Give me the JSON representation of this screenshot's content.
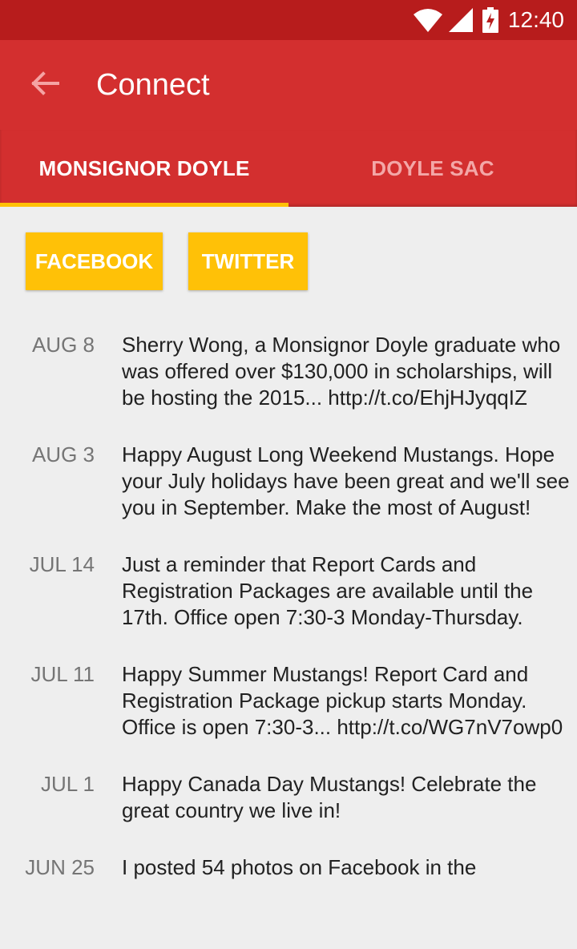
{
  "status_bar": {
    "time": "12:40"
  },
  "toolbar": {
    "title": "Connect"
  },
  "tabs": [
    {
      "label": "MONSIGNOR DOYLE"
    },
    {
      "label": "DOYLE SAC"
    }
  ],
  "buttons": {
    "facebook": "FACEBOOK",
    "twitter": "TWITTER"
  },
  "feed": [
    {
      "date": "AUG 8",
      "text": "Sherry Wong, a Monsignor Doyle graduate who was offered over $130,000 in scholarships, will be hosting the 2015... http://t.co/EhjHJyqqIZ"
    },
    {
      "date": "AUG 3",
      "text": "Happy August Long Weekend Mustangs. Hope your July holidays have been great and we'll see you in September. Make the most of August!"
    },
    {
      "date": "JUL 14",
      "text": "Just a reminder that Report Cards and Registration Packages are available until the 17th. Office open 7:30-3 Monday-Thursday."
    },
    {
      "date": "JUL 11",
      "text": "Happy Summer Mustangs! Report Card and Registration Package pickup starts Monday. Office is open 7:30-3... http://t.co/WG7nV7owp0"
    },
    {
      "date": "JUL 1",
      "text": "Happy Canada Day Mustangs! Celebrate the great country we live in!"
    },
    {
      "date": "JUN 25",
      "text": "I posted 54 photos on Facebook in the"
    }
  ],
  "colors": {
    "status_bar": "#b71c1c",
    "primary": "#d32f2f",
    "accent": "#ffc107",
    "background": "#eeeeee"
  },
  "icons": [
    "wifi-icon",
    "signal-icon",
    "battery-charging-icon",
    "back-arrow-icon"
  ]
}
